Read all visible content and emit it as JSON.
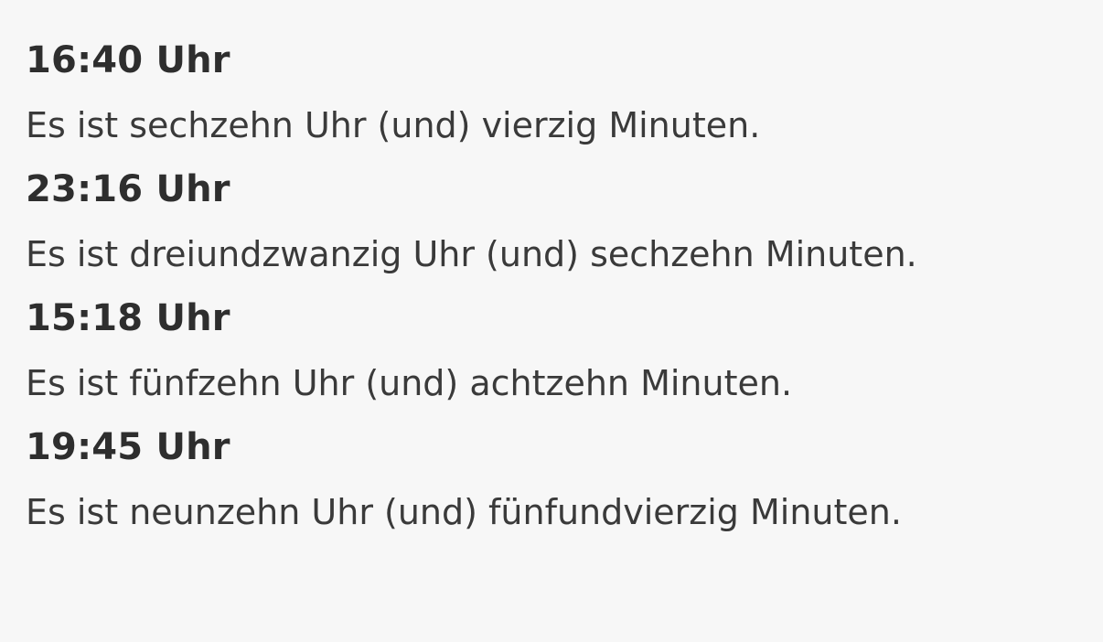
{
  "entries": [
    {
      "time": "16:40 Uhr",
      "sentence": "Es ist sechzehn Uhr (und) vierzig Minuten."
    },
    {
      "time": "23:16 Uhr",
      "sentence": "Es ist dreiundzwanzig Uhr (und) sechzehn Minuten."
    },
    {
      "time": "15:18 Uhr",
      "sentence": "Es ist fünfzehn Uhr (und) achtzehn Minuten."
    },
    {
      "time": "19:45 Uhr",
      "sentence": "Es ist neunzehn Uhr (und) fünfundvierzig Minuten."
    }
  ]
}
